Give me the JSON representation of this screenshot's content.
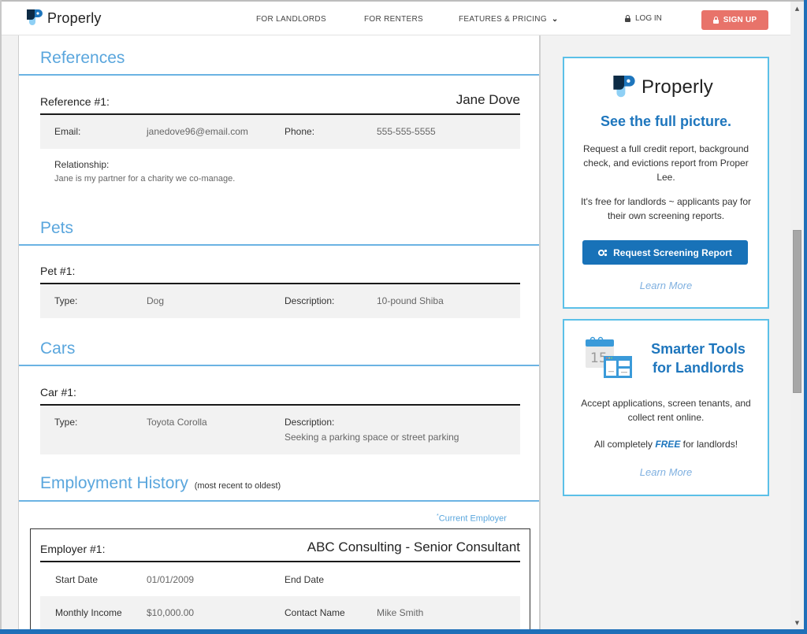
{
  "header": {
    "brand": "Properly",
    "nav": [
      {
        "label": "FOR LANDLORDS"
      },
      {
        "label": "FOR RENTERS"
      },
      {
        "label": "FEATURES & PRICING"
      }
    ],
    "login_label": "LOG IN",
    "signup_label": "SIGN UP"
  },
  "references": {
    "title": "References",
    "items": [
      {
        "label": "Reference #1:",
        "name": "Jane Dove",
        "email_label": "Email:",
        "email": "janedove96@email.com",
        "phone_label": "Phone:",
        "phone": "555-555-5555",
        "relationship_label": "Relationship:",
        "relationship": "Jane is my partner for a charity we co-manage."
      }
    ]
  },
  "pets": {
    "title": "Pets",
    "items": [
      {
        "label": "Pet #1:",
        "type_label": "Type:",
        "type": "Dog",
        "description_label": "Description:",
        "description": "10-pound Shiba"
      }
    ]
  },
  "cars": {
    "title": "Cars",
    "items": [
      {
        "label": "Car #1:",
        "type_label": "Type:",
        "type": "Toyota Corolla",
        "description_label": "Description:",
        "description": "Seeking a parking space or street parking"
      }
    ]
  },
  "employment": {
    "title": "Employment History",
    "note": "(most recent to oldest)",
    "current_marker": "*",
    "current_label": "Current Employer",
    "items": [
      {
        "label": "Employer #1:",
        "name": "ABC Consulting - Senior Consultant",
        "start_label": "Start Date",
        "start": "01/01/2009",
        "end_label": "End Date",
        "end": "",
        "income_label": "Monthly Income",
        "income": "$10,000.00",
        "contact_label": "Contact Name",
        "contact": "Mike Smith"
      }
    ]
  },
  "sidebar": {
    "screening": {
      "brand": "Properly",
      "headline": "See the full picture.",
      "body1": "Request a full credit report, background check, and evictions report from Proper Lee.",
      "body2": "It's free for landlords ~ applicants pay for their own screening reports.",
      "button": "Request Screening Report",
      "learn_more": "Learn More"
    },
    "tools": {
      "headline": "Smarter Tools for Landlords",
      "calendar_day": "15",
      "body1": "Accept applications, screen tenants, and collect rent online.",
      "body2_pre": "All completely",
      "body2_em": "FREE",
      "body2_post": "for landlords!",
      "learn_more": "Learn More"
    }
  },
  "colors": {
    "accent_blue": "#5aa6dd",
    "brand_blue": "#1e76bd",
    "button_blue": "#1872b8",
    "signup_red": "#e8736a",
    "card_border": "#5bc0e8"
  }
}
